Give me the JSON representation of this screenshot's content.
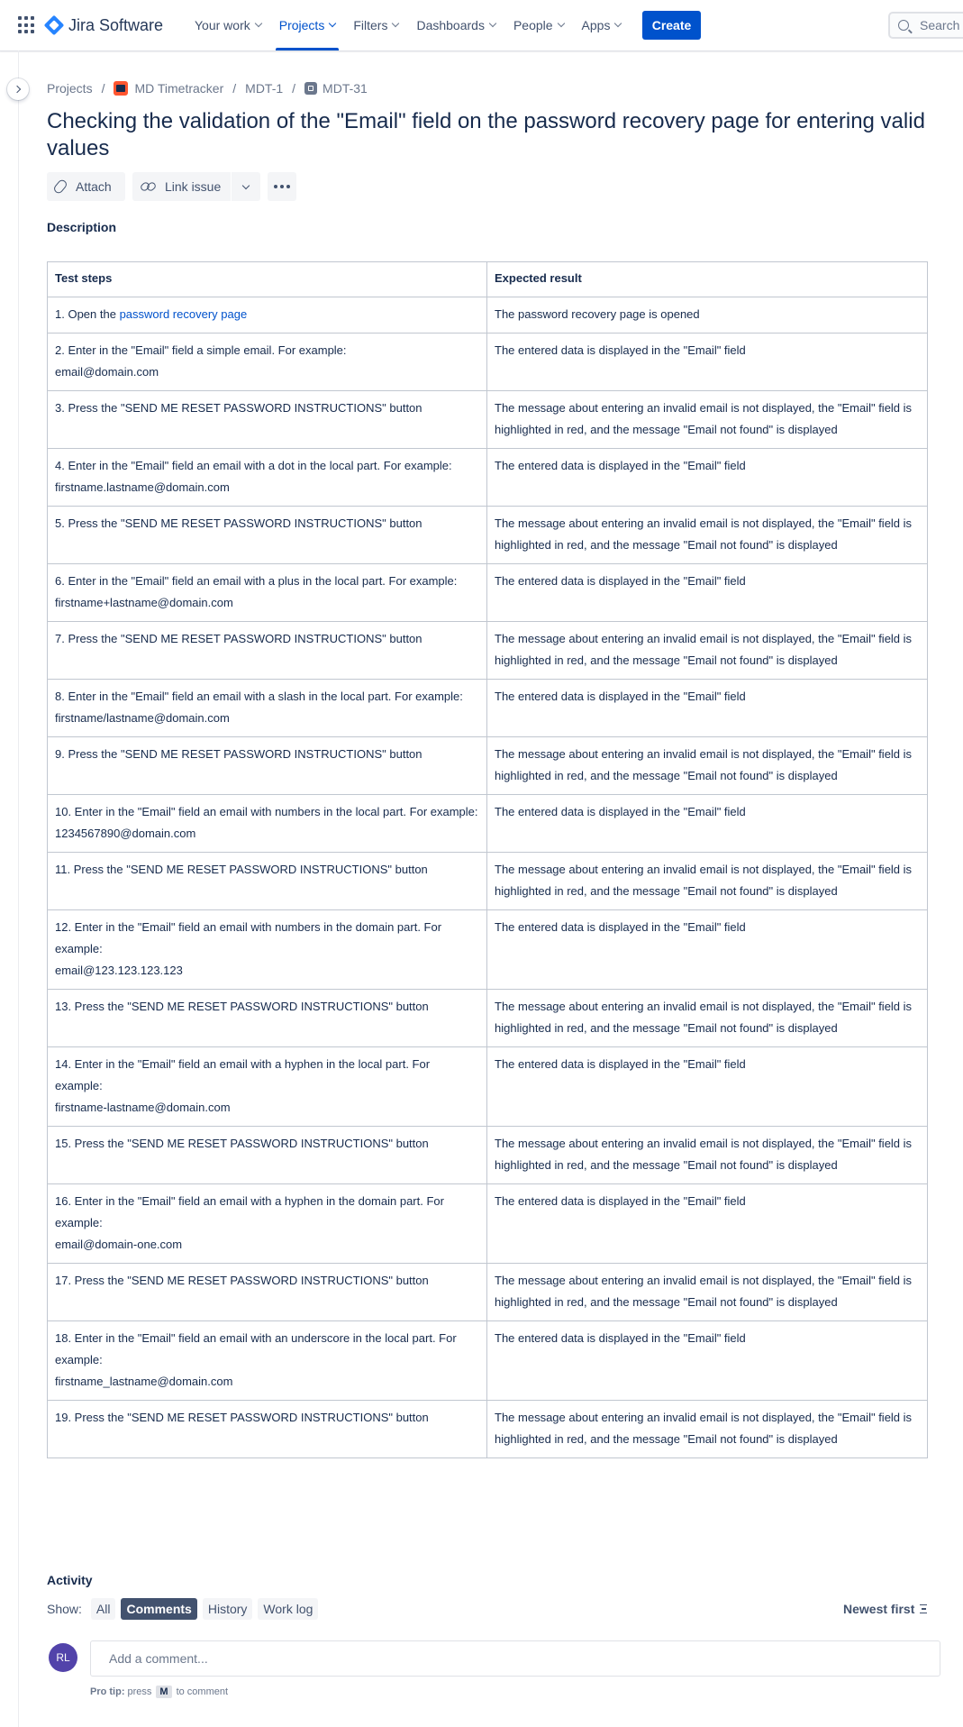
{
  "nav": {
    "logo_text": "Jira Software",
    "items": [
      {
        "label": "Your work",
        "active": false
      },
      {
        "label": "Projects",
        "active": true
      },
      {
        "label": "Filters",
        "active": false
      },
      {
        "label": "Dashboards",
        "active": false
      },
      {
        "label": "People",
        "active": false
      },
      {
        "label": "Apps",
        "active": false
      }
    ],
    "create_label": "Create",
    "search_placeholder": "Search"
  },
  "breadcrumb": {
    "projects": "Projects",
    "project": "MD Timetracker",
    "parent": "MDT-1",
    "issue": "MDT-31"
  },
  "issue": {
    "title": "Checking the validation of the \"Email\" field on the password recovery page for entering valid values"
  },
  "toolbar": {
    "attach_label": "Attach",
    "link_label": "Link issue"
  },
  "description": {
    "label": "Description",
    "headers": [
      "Test steps",
      "Expected result"
    ],
    "rows": [
      {
        "step_prefix": "1. Open the ",
        "step_link": "password recovery page",
        "step": "",
        "result": "The password recovery page is opened"
      },
      {
        "step": "2. Enter in the \"Email\" field a simple email. For example:\nemail@domain.com",
        "result": "The entered data is displayed in the \"Email\" field"
      },
      {
        "step": "3. Press the \"SEND ME RESET PASSWORD INSTRUCTIONS\" button",
        "result": "The message about entering an invalid email is not displayed, the \"Email\" field is highlighted in red, and the message \"Email not found\" is displayed"
      },
      {
        "step": "4. Enter in the \"Email\" field an email with a dot in the local part. For example:\nfirstname.lastname@domain.com",
        "result": "The entered data is displayed in the \"Email\" field"
      },
      {
        "step": "5. Press the \"SEND ME RESET PASSWORD INSTRUCTIONS\" button",
        "result": "The message about entering an invalid email is not displayed, the \"Email\" field is highlighted in red, and the message \"Email not found\" is displayed"
      },
      {
        "step": "6. Enter in the \"Email\" field an email with a plus in the local part. For example:\nfirstname+lastname@domain.com",
        "result": "The entered data is displayed in the \"Email\" field"
      },
      {
        "step": "7. Press the \"SEND ME RESET PASSWORD INSTRUCTIONS\" button",
        "result": "The message about entering an invalid email is not displayed, the \"Email\" field is highlighted in red, and the message \"Email not found\" is displayed"
      },
      {
        "step": "8. Enter in the \"Email\" field an email with a slash in the local part. For example:\nfirstname/lastname@domain.com",
        "result": "The entered data is displayed in the \"Email\" field"
      },
      {
        "step": "9. Press the \"SEND ME RESET PASSWORD INSTRUCTIONS\" button",
        "result": "The message about entering an invalid email is not displayed, the \"Email\" field is highlighted in red, and the message \"Email not found\" is displayed"
      },
      {
        "step": "10. Enter in the \"Email\" field an email with numbers in the local part. For example:\n1234567890@domain.com",
        "result": "The entered data is displayed in the \"Email\" field"
      },
      {
        "step": "11. Press the \"SEND ME RESET PASSWORD INSTRUCTIONS\" button",
        "result": "The message about entering an invalid email is not displayed, the \"Email\" field is highlighted in red, and the message \"Email not found\" is displayed"
      },
      {
        "step": "12. Enter in the \"Email\" field an email with numbers in the domain part. For example:\nemail@123.123.123.123",
        "result": "The entered data is displayed in the \"Email\" field"
      },
      {
        "step": "13. Press the \"SEND ME RESET PASSWORD INSTRUCTIONS\" button",
        "result": "The message about entering an invalid email is not displayed, the \"Email\" field is highlighted in red, and the message \"Email not found\" is displayed"
      },
      {
        "step": "14. Enter in the \"Email\" field an email with a hyphen in the local part. For example:\nfirstname-lastname@domain.com",
        "result": "The entered data is displayed in the \"Email\" field"
      },
      {
        "step": "15. Press the \"SEND ME RESET PASSWORD INSTRUCTIONS\" button",
        "result": "The message about entering an invalid email is not displayed, the \"Email\" field is highlighted in red, and the message \"Email not found\" is displayed"
      },
      {
        "step": "16. Enter in the \"Email\" field an email with a hyphen in the domain part. For example:\nemail@domain-one.com",
        "result": "The entered data is displayed in the \"Email\" field"
      },
      {
        "step": "17. Press the \"SEND ME RESET PASSWORD INSTRUCTIONS\" button",
        "result": "The message about entering an invalid email is not displayed, the \"Email\" field is highlighted in red, and the message \"Email not found\" is displayed"
      },
      {
        "step": "18. Enter in the \"Email\" field an email with an underscore in the local part. For example:\nfirstname_lastname@domain.com",
        "result": "The entered data is displayed in the \"Email\" field"
      },
      {
        "step": "19. Press the \"SEND ME RESET PASSWORD INSTRUCTIONS\" button",
        "result": "The message about entering an invalid email is not displayed, the \"Email\" field is highlighted in red, and the message \"Email not found\" is displayed"
      }
    ]
  },
  "activity": {
    "label": "Activity",
    "show_label": "Show:",
    "filters": [
      {
        "label": "All",
        "selected": false
      },
      {
        "label": "Comments",
        "selected": true
      },
      {
        "label": "History",
        "selected": false
      },
      {
        "label": "Work log",
        "selected": false
      }
    ],
    "sort_label": "Newest first",
    "avatar_initials": "RL",
    "comment_placeholder": "Add a comment...",
    "pro_tip_label": "Pro tip:",
    "pro_tip_press": "press",
    "pro_tip_key": "M",
    "pro_tip_suffix": "to comment"
  }
}
